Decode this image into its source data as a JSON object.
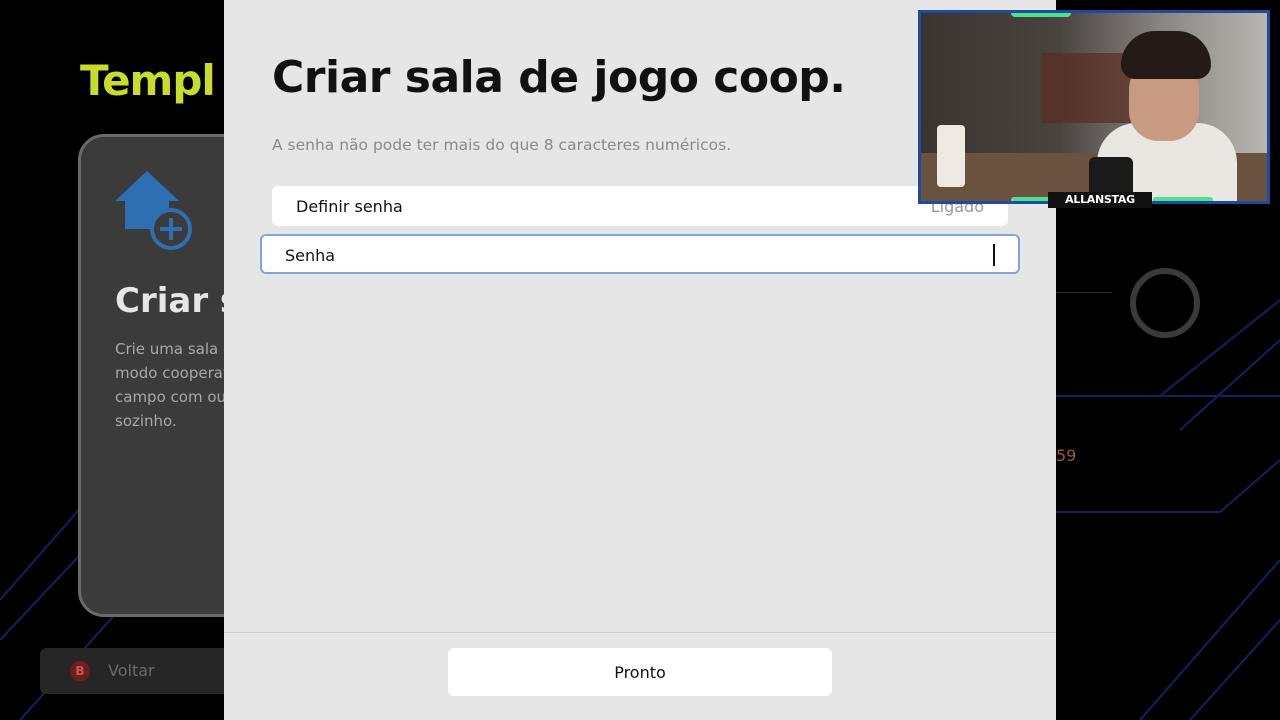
{
  "background": {
    "title": "Templ",
    "card": {
      "title": "Criar s",
      "description": [
        "Crie uma sala d",
        "modo cooperat",
        "campo com out",
        "sozinho."
      ]
    },
    "back_button": {
      "key": "B",
      "label": "Voltar"
    },
    "right_value": "59"
  },
  "modal": {
    "title": "Criar sala de jogo coop.",
    "hint": "A senha não pode ter mais do que 8 caracteres numéricos.",
    "toggle": {
      "label": "Definir senha",
      "value": "Ligado"
    },
    "password_field": {
      "label": "Senha"
    },
    "done_button": "Pronto"
  },
  "webcam": {
    "streamer_name": "ALLANSTAG"
  },
  "colors": {
    "modal_bg": "#e6e6e6",
    "accent_field_border": "#7fa6d9",
    "bg_title": "#c8dc2a",
    "icon_blue": "#2d6fb0",
    "webcam_border": "#1e4aa0",
    "webcam_glow": "#4de38a"
  }
}
